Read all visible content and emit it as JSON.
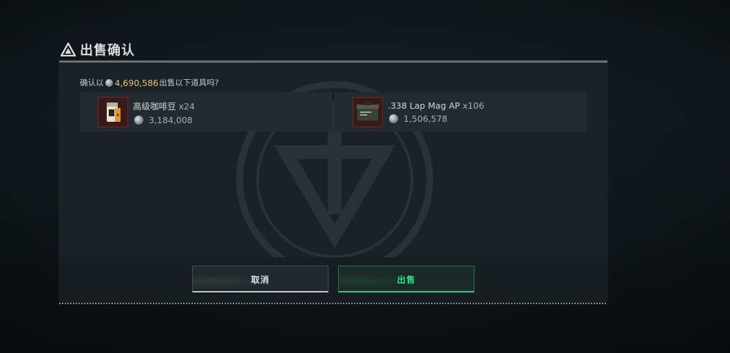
{
  "dialog": {
    "title": "出售确认",
    "prompt_prefix": "确认以",
    "total_price": "4,690,586",
    "prompt_suffix": "出售以下道具吗?"
  },
  "items": [
    {
      "name": "高级咖啡豆",
      "qty": "x24",
      "price": "3,184,008",
      "icon": "coffee-beans-bag-icon"
    },
    {
      "name": ".338 Lap Mag AP",
      "qty": "x106",
      "price": "1,506,578",
      "icon": "ammo-box-icon"
    }
  ],
  "buttons": {
    "cancel_label": "取消",
    "sell_label": "出售"
  },
  "colors": {
    "accent_green": "#2fe08e",
    "price_gold": "#e6c46a",
    "item_frame_red": "#6b2c27"
  }
}
